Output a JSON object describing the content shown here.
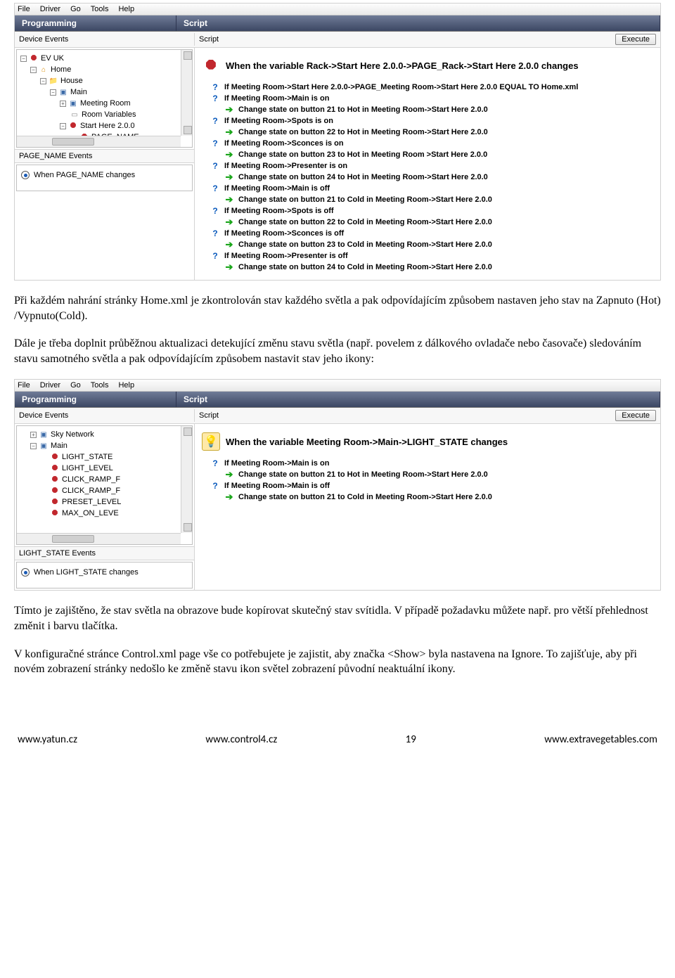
{
  "menus": [
    "File",
    "Driver",
    "Go",
    "Tools",
    "Help"
  ],
  "tabs": {
    "programming": "Programming",
    "script": "Script"
  },
  "subhead": {
    "left": "Device Events",
    "right": "Script",
    "execute": "Execute"
  },
  "shot1": {
    "tree": [
      {
        "indent": 0,
        "exp": "-",
        "icon": "c4",
        "text": "EV UK"
      },
      {
        "indent": 1,
        "exp": "-",
        "icon": "home",
        "text": "Home"
      },
      {
        "indent": 2,
        "exp": "-",
        "icon": "folder",
        "text": "House"
      },
      {
        "indent": 3,
        "exp": "-",
        "icon": "box",
        "text": "Main"
      },
      {
        "indent": 4,
        "exp": "+",
        "icon": "box",
        "text": "Meeting Room"
      },
      {
        "indent": 4,
        "exp": "",
        "icon": "page",
        "text": "Room Variables"
      },
      {
        "indent": 4,
        "exp": "-",
        "icon": "c4",
        "text": "Start Here 2.0.0"
      },
      {
        "indent": 5,
        "exp": "",
        "icon": "c4",
        "text": "PAGE_NAME"
      }
    ],
    "section": "PAGE_NAME Events",
    "radio": "When PAGE_NAME changes",
    "headline_icon": "c4",
    "headline": "When the variable Rack->Start Here 2.0.0->PAGE_Rack->Start Here 2.0.0 changes",
    "lines": [
      {
        "t": "q",
        "d": 1,
        "text": "If Meeting Room->Start Here 2.0.0->PAGE_Meeting Room->Start Here 2.0.0 EQUAL TO Home.xml"
      },
      {
        "t": "q",
        "d": 1,
        "text": "If Meeting Room->Main is on"
      },
      {
        "t": "a",
        "d": 2,
        "text": "Change state on button 21 to Hot in Meeting Room->Start Here 2.0.0"
      },
      {
        "t": "q",
        "d": 1,
        "text": "If Meeting Room->Spots is on"
      },
      {
        "t": "a",
        "d": 2,
        "text": "Change state on button 22 to Hot in Meeting Room->Start Here 2.0.0"
      },
      {
        "t": "q",
        "d": 1,
        "text": "If Meeting Room->Sconces is on"
      },
      {
        "t": "a",
        "d": 2,
        "text": "Change state on button 23 to Hot in Meeting Room >Start Here 2.0.0"
      },
      {
        "t": "q",
        "d": 1,
        "text": "If Meeting Room->Presenter is on"
      },
      {
        "t": "a",
        "d": 2,
        "text": "Change state on button 24 to Hot in Meeting Room->Start Here 2.0.0"
      },
      {
        "t": "q",
        "d": 1,
        "text": "If Meeting Room->Main is off"
      },
      {
        "t": "a",
        "d": 2,
        "text": "Change state on button 21 to Cold in Meeting Room->Start Here 2.0.0"
      },
      {
        "t": "q",
        "d": 1,
        "text": "If Meeting Room->Spots is off"
      },
      {
        "t": "a",
        "d": 2,
        "text": "Change state on button 22 to Cold in Meeting Room->Start Here 2.0.0"
      },
      {
        "t": "q",
        "d": 1,
        "text": "If Meeting Room->Sconces is off"
      },
      {
        "t": "a",
        "d": 2,
        "text": "Change state on button 23 to Cold in Meeting Room->Start Here 2.0.0"
      },
      {
        "t": "q",
        "d": 1,
        "text": "If Meeting Room->Presenter is off"
      },
      {
        "t": "a",
        "d": 2,
        "text": "Change state on button 24 to Cold in Meeting Room->Start Here 2.0.0"
      }
    ]
  },
  "para1": "Při každém nahrání stránky Home.xml  je zkontrolován stav každého světla a pak odpovídajícím způsobem nastaven jeho stav na Zapnuto (Hot) /Vypnuto(Cold).",
  "para2": "Dále je třeba doplnit průběžnou aktualizaci detekující změnu stavu světla (např. povelem z dálkového ovladače nebo časovače) sledováním stavu samotného světla a pak odpovídajícím způsobem nastavit stav jeho ikony:",
  "shot2": {
    "tree": [
      {
        "indent": 1,
        "exp": "+",
        "icon": "box",
        "text": "Sky Network"
      },
      {
        "indent": 1,
        "exp": "-",
        "icon": "box",
        "text": "Main"
      },
      {
        "indent": 2,
        "exp": "",
        "icon": "c4",
        "text": "LIGHT_STATE"
      },
      {
        "indent": 2,
        "exp": "",
        "icon": "c4",
        "text": "LIGHT_LEVEL"
      },
      {
        "indent": 2,
        "exp": "",
        "icon": "c4",
        "text": "CLICK_RAMP_F"
      },
      {
        "indent": 2,
        "exp": "",
        "icon": "c4",
        "text": "CLICK_RAMP_F"
      },
      {
        "indent": 2,
        "exp": "",
        "icon": "c4",
        "text": "PRESET_LEVEL"
      },
      {
        "indent": 2,
        "exp": "",
        "icon": "c4",
        "text": "MAX_ON_LEVE"
      }
    ],
    "section": "LIGHT_STATE Events",
    "radio": "When LIGHT_STATE changes",
    "headline_icon": "light",
    "headline": "When the variable Meeting Room->Main->LIGHT_STATE changes",
    "lines": [
      {
        "t": "q",
        "d": 1,
        "text": "If Meeting Room->Main is on"
      },
      {
        "t": "a",
        "d": 2,
        "text": "Change state on button 21 to Hot in Meeting Room->Start Here 2.0.0"
      },
      {
        "t": "q",
        "d": 1,
        "text": "If Meeting Room->Main is off"
      },
      {
        "t": "a",
        "d": 2,
        "text": "Change state on button 21 to Cold in Meeting Room->Start Here 2.0.0"
      }
    ]
  },
  "para3": "Tímto je zajištěno, že stav světla na obrazove bude kopírovat skutečný stav svítidla. V případě požadavku můžete např. pro větší přehlednost změnit i barvu tlačítka.",
  "para4": "V konfiguračné stránce Control.xml page vše co potřebujete je zajistit, aby značka <Show>  byla nastavena na Ignore. To zajišťuje, aby při novém zobrazení stránky nedošlo ke změně stavu ikon světel zobrazení původní neaktuální ikony.",
  "footer": {
    "left": "www.yatun.cz",
    "mid1": "www.control4.cz",
    "page": "19",
    "right": "www.extravegetables.com"
  }
}
